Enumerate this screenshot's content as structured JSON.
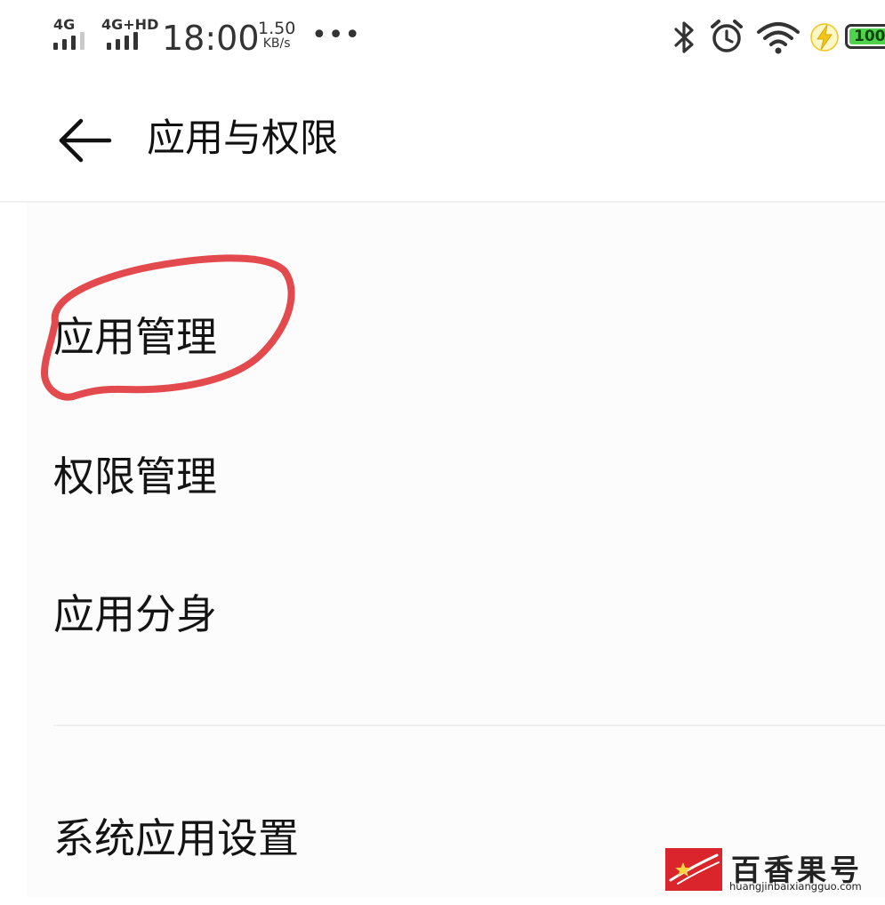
{
  "status_bar": {
    "signal1_label": "4G",
    "signal2_label": "4G+HD",
    "time": "18:00",
    "speed_value": "1.50",
    "speed_unit": "KB/s",
    "more": "•••",
    "battery_level": "100",
    "icons": [
      "bluetooth-icon",
      "alarm-icon",
      "wifi-icon",
      "charging-icon",
      "battery-icon"
    ]
  },
  "header": {
    "title": "应用与权限",
    "back_icon": "arrow-left-icon"
  },
  "list": {
    "items": [
      {
        "label": "应用管理"
      },
      {
        "label": "权限管理"
      },
      {
        "label": "应用分身"
      },
      {
        "label": "系统应用设置"
      }
    ]
  },
  "annotation": {
    "color": "#e0363a",
    "target": "应用管理"
  },
  "watermark": {
    "name": "百香果号",
    "url": "huangjinbaixiangguo.com",
    "logo_color": "#d9252b"
  },
  "colors": {
    "battery_fill": "#4fd34c",
    "charging_bolt": "#f2c518"
  }
}
